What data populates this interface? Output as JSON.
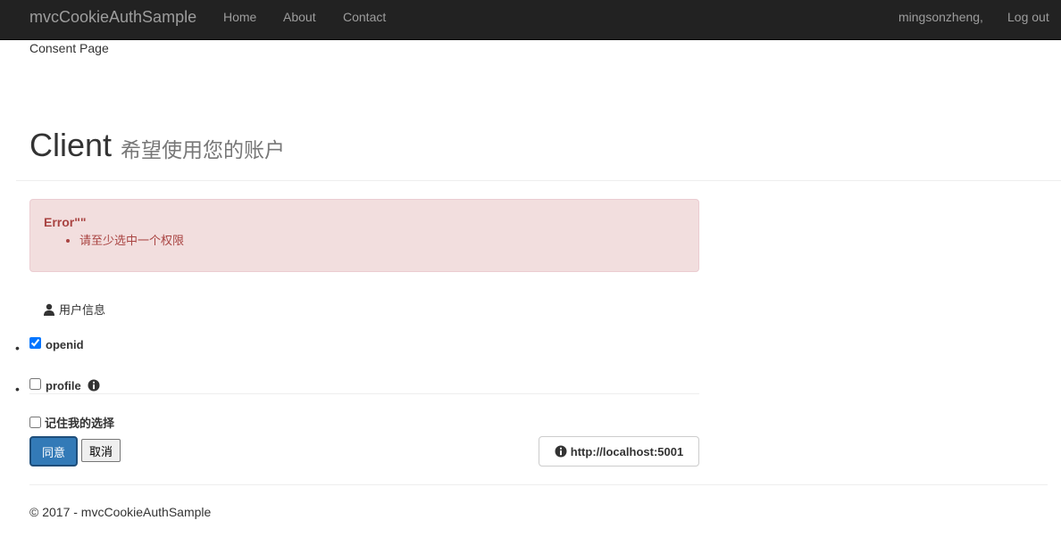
{
  "navbar": {
    "brand": "mvcCookieAuthSample",
    "links": [
      "Home",
      "About",
      "Contact"
    ],
    "user": "mingsonzheng,",
    "logout": "Log out"
  },
  "page": {
    "consent_label": "Consent Page",
    "client_name": "Client",
    "subtitle": "希望使用您的账户"
  },
  "alert": {
    "title": "Error\"\"",
    "messages": [
      "请至少选中一个权限"
    ]
  },
  "scopes": {
    "heading": "用户信息",
    "heading_icon": "user-icon",
    "items": [
      {
        "label": "openid",
        "checked": true
      },
      {
        "label": "profile",
        "checked": false,
        "info_icon": "info-circle-icon"
      }
    ]
  },
  "remember_label": "记住我的选择",
  "buttons": {
    "allow": "同意",
    "cancel": "取消"
  },
  "client_url": {
    "icon": "info-circle-icon",
    "text": "http://localhost:5001"
  },
  "footer": "© 2017 - mvcCookieAuthSample",
  "colors": {
    "navbar_bg": "#222222",
    "nav_text": "#9d9d9d",
    "alert_bg": "#f2dede",
    "alert_text": "#a94442",
    "primary": "#337ab7"
  }
}
